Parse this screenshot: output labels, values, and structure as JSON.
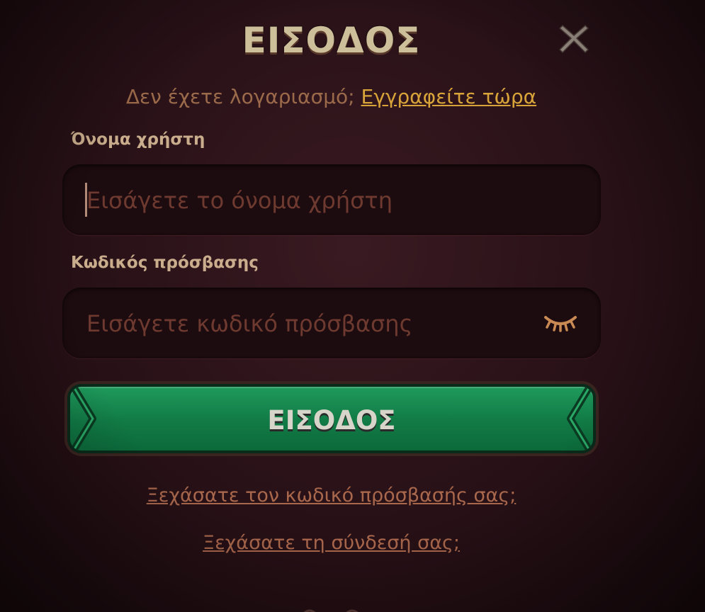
{
  "modal": {
    "title": "ΕΙΣΟΔΟΣ",
    "close_icon": "close-x-icon"
  },
  "signup": {
    "prompt": "Δεν έχετε λογαριασμό;",
    "link": "Εγγραφείτε τώρα"
  },
  "username": {
    "label": "Όνομα χρήστη",
    "placeholder": "Εισάγετε το όνομα χρήστη",
    "value": ""
  },
  "password": {
    "label": "Κωδικός πρόσβασης",
    "placeholder": "Εισάγετε κωδικό πρόσβασης",
    "value": "",
    "toggle_icon": "eye-closed-icon"
  },
  "submit": {
    "label": "ΕΙΣΟΔΟΣ"
  },
  "links": {
    "forgot_password": "Ξεχάσατε τον κωδικό πρόσβασής σας;",
    "forgot_login": "Ξεχάσατε τη σύνδεσή σας;"
  },
  "colors": {
    "background": "#2a1218",
    "title": "#cdbf9a",
    "accent_link": "#d8a43a",
    "muted_link": "#a9674c",
    "button_green": "#117a45",
    "field_bg": "#1c0b0f"
  }
}
